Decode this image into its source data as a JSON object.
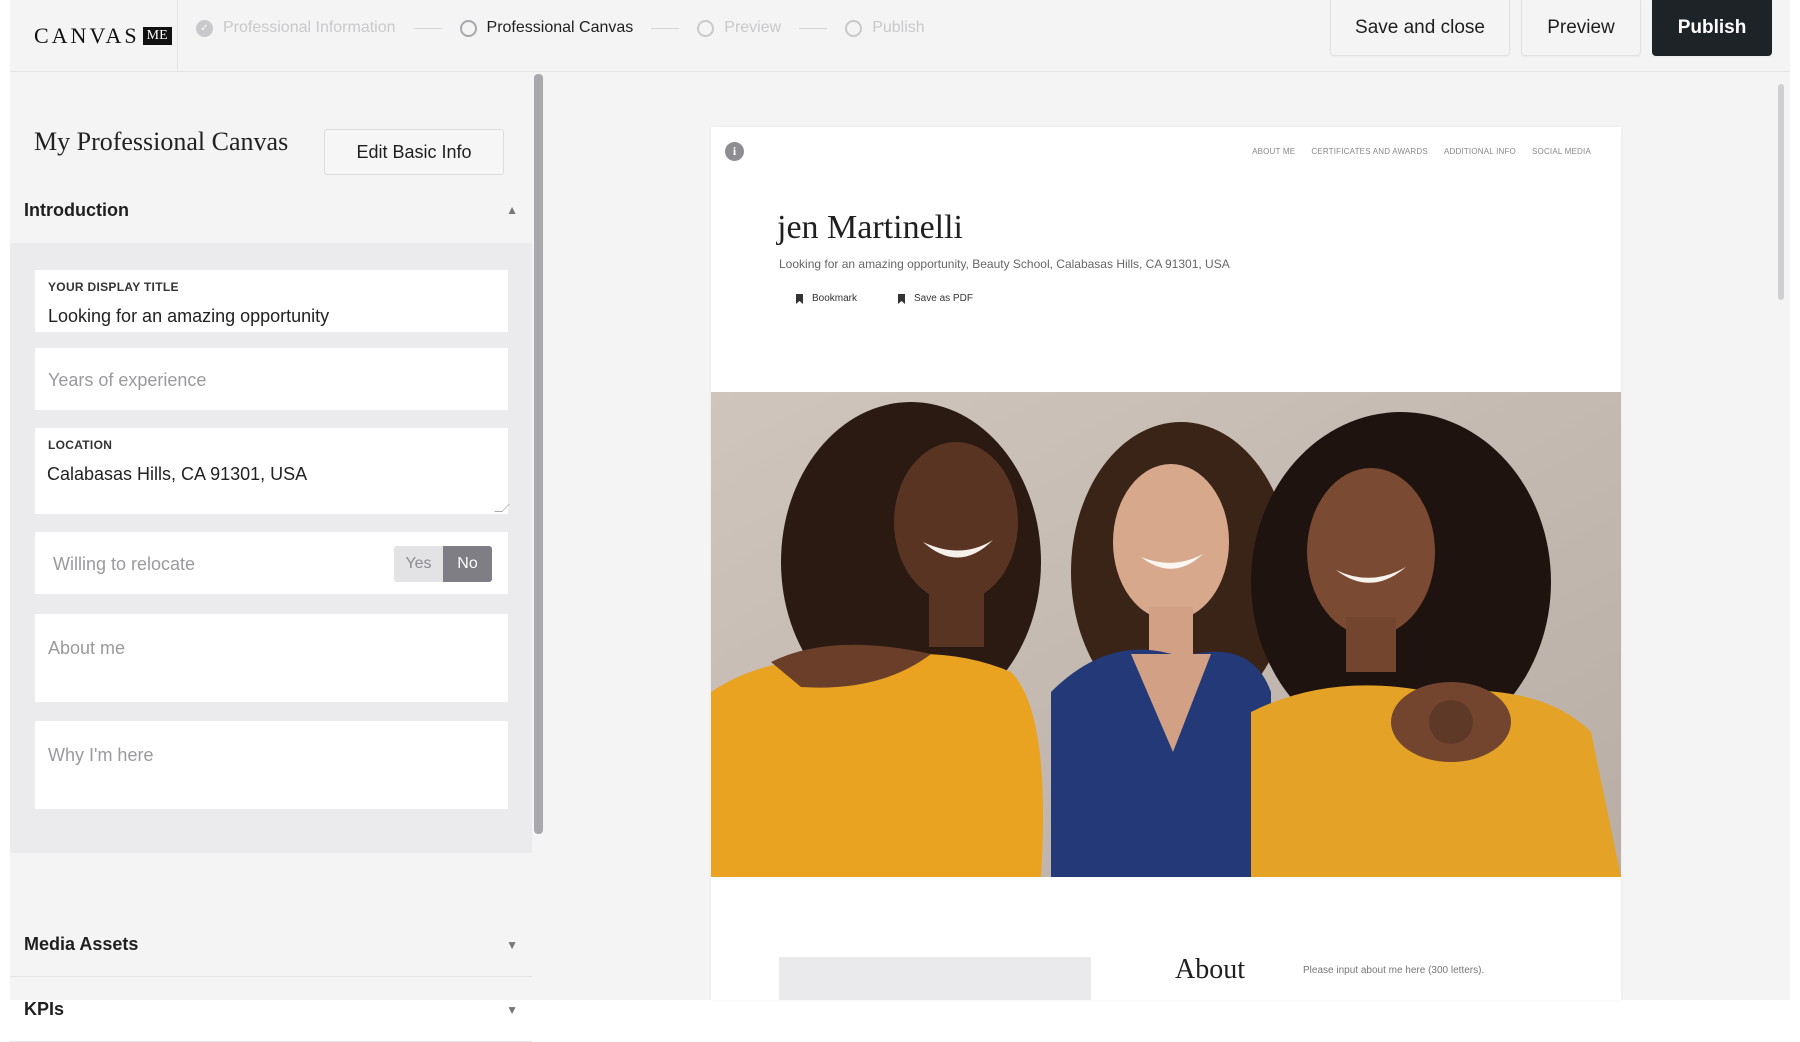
{
  "header": {
    "logo_text": "CANVAS",
    "logo_badge": "ME",
    "steps": [
      {
        "label": "Professional Information",
        "state": "done"
      },
      {
        "label": "Professional Canvas",
        "state": "active"
      },
      {
        "label": "Preview",
        "state": "pending"
      },
      {
        "label": "Publish",
        "state": "pending"
      }
    ],
    "save_close_label": "Save and close",
    "preview_label": "Preview",
    "publish_label": "Publish"
  },
  "sidebar": {
    "title": "My Professional Canvas",
    "edit_basic_label": "Edit Basic Info",
    "introduction": {
      "heading": "Introduction",
      "display_title": {
        "label": "YOUR DISPLAY TITLE",
        "value": "Looking for an amazing opportunity"
      },
      "years_placeholder": "Years of experience",
      "location": {
        "label": "LOCATION",
        "value": "Calabasas Hills, CA 91301, USA"
      },
      "relocate": {
        "placeholder": "Willing to relocate",
        "yes_label": "Yes",
        "no_label": "No",
        "selected": "No"
      },
      "about_placeholder": "About me",
      "why_placeholder": "Why I'm here"
    },
    "media_heading": "Media Assets",
    "kpis_heading": "KPIs"
  },
  "preview": {
    "info_icon": "i",
    "nav": [
      "ABOUT ME",
      "CERTIFICATES AND AWARDS",
      "ADDITIONAL INFO",
      "SOCIAL MEDIA"
    ],
    "name": "jen Martinelli",
    "subtitle": "Looking for an amazing opportunity, Beauty School, Calabasas Hills, CA 91301, USA",
    "bookmark_label": "Bookmark",
    "save_pdf_label": "Save as PDF",
    "about_heading": "About",
    "about_hint": "Please input about me here (300 letters)."
  },
  "colors": {
    "publish_bg": "#1e2328",
    "page_bg": "#f4f4f5",
    "toggle_selected": "#7e7e84"
  }
}
